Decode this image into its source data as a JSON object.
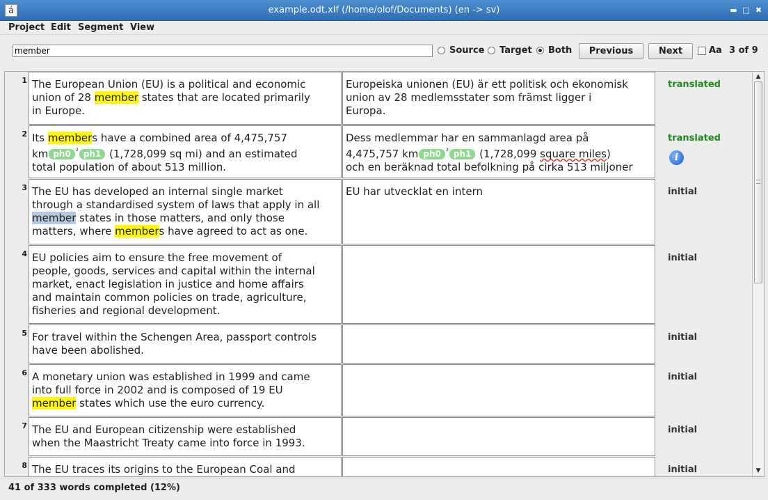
{
  "window": {
    "title": "example.odt.xlf (/home/olof/Documents) (en -> sv)",
    "app_icon": "á"
  },
  "menu": [
    "Project",
    "Edit",
    "Segment",
    "View"
  ],
  "search": {
    "value": "member",
    "radio_source": "Source",
    "radio_target": "Target",
    "radio_both": "Both",
    "selected": "Both",
    "previous_label": "Previous",
    "next_label": "Next",
    "case_label": "Aa",
    "match_count": "3 of 9"
  },
  "segments": [
    {
      "num": "1",
      "source": [
        "The European Union (EU) is a political and economic",
        "union of 28 ",
        "member",
        " states that are located primarily",
        "in Europe."
      ],
      "target": [
        "Europeiska unionen (EU) är ett politisk och ekonomisk",
        "union av 28 medlemsstater som främst ligger i",
        "Europa."
      ],
      "status": "translated"
    },
    {
      "num": "2",
      "source": [
        "Its ",
        "member",
        "s have a combined area of 4,475,757",
        "km",
        "ph0",
        "²",
        "ph1",
        " (1,728,099 sq mi) and an estimated",
        "total population of about 513 million."
      ],
      "target": [
        "Dess medlemmar har en sammanlagd area på",
        "4,475,757 km",
        "ph0",
        "²",
        "ph1",
        " (1,728,099 ",
        "square miles",
        ")",
        "och en beräknad total befolkning på cirka 513 miljoner"
      ],
      "status": "translated"
    },
    {
      "num": "3",
      "source": [
        "The EU has developed an internal single market",
        "through a standardised system of laws that apply in all",
        "member",
        " states in those matters, and only those",
        "matters, where ",
        "member",
        "s have agreed to act as one."
      ],
      "target": [
        "EU har utvecklat en intern"
      ],
      "status": "initial"
    },
    {
      "num": "4",
      "source": [
        "EU policies aim to ensure the free movement of",
        "people, goods, services and capital within the internal",
        "market, enact legislation in justice and home affairs",
        "and maintain common policies on trade, agriculture,",
        "fisheries and regional development."
      ],
      "target": [],
      "status": "initial"
    },
    {
      "num": "5",
      "source": [
        "For travel within the Schengen Area, passport controls",
        "have been abolished."
      ],
      "target": [],
      "status": "initial"
    },
    {
      "num": "6",
      "source": [
        "A monetary union was established in 1999 and came",
        "into full force in 2002 and is composed of 19 EU",
        "member",
        " states which use the euro currency."
      ],
      "target": [],
      "status": "initial"
    },
    {
      "num": "7",
      "source": [
        "The EU and European citizenship were established",
        "when the Maastricht Treaty came into force in 1993."
      ],
      "target": [],
      "status": "initial"
    },
    {
      "num": "8",
      "source": [
        "The EU traces its origins to the European Coal and"
      ],
      "target": [],
      "status": "initial"
    }
  ],
  "footer": {
    "progress_text": "41 of 333 words completed (12%)",
    "progress_fraction": 0.12
  },
  "colors": {
    "titlebar": "#3a7cc4",
    "highlight": "#fff800",
    "current_match": "#b7c9de",
    "tag": "#8fd88f",
    "translated": "#1e8a1e"
  }
}
